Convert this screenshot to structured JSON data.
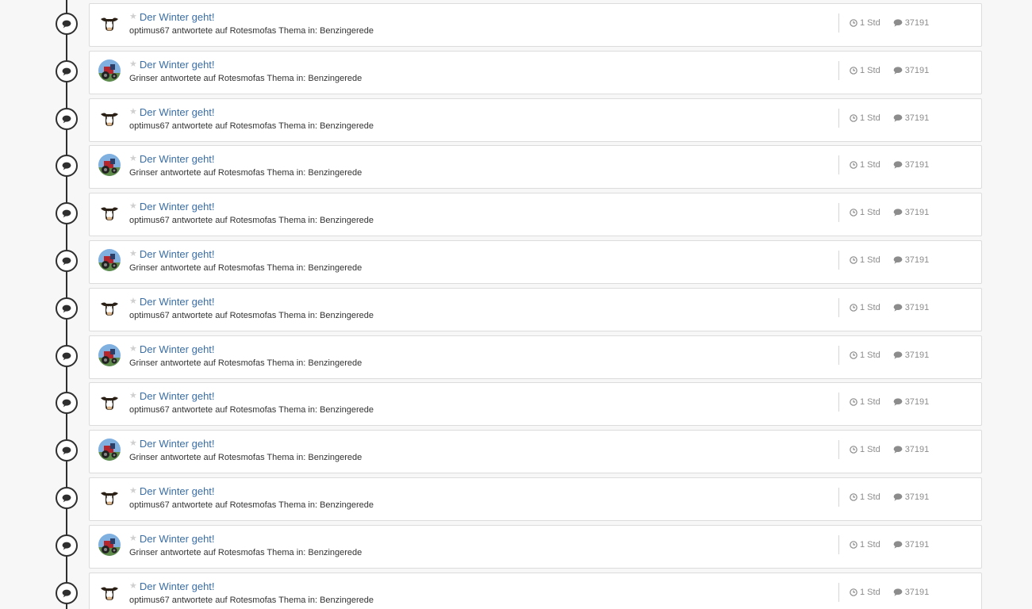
{
  "activities": [
    {
      "title": "Der Winter geht!",
      "subtitle": "optimus67 antwortete auf Rotesmofas Thema in: Benzingerede",
      "avatar": "cow-avatar",
      "time": "1 Std",
      "replies": "37191"
    },
    {
      "title": "Der Winter geht!",
      "subtitle": "Grinser antwortete auf Rotesmofas Thema in: Benzingerede",
      "avatar": "tractor-avatar",
      "time": "1 Std",
      "replies": "37191"
    },
    {
      "title": "Der Winter geht!",
      "subtitle": "optimus67 antwortete auf Rotesmofas Thema in: Benzingerede",
      "avatar": "cow-avatar",
      "time": "1 Std",
      "replies": "37191"
    },
    {
      "title": "Der Winter geht!",
      "subtitle": "Grinser antwortete auf Rotesmofas Thema in: Benzingerede",
      "avatar": "tractor-avatar",
      "time": "1 Std",
      "replies": "37191"
    },
    {
      "title": "Der Winter geht!",
      "subtitle": "optimus67 antwortete auf Rotesmofas Thema in: Benzingerede",
      "avatar": "cow-avatar",
      "time": "1 Std",
      "replies": "37191"
    },
    {
      "title": "Der Winter geht!",
      "subtitle": "Grinser antwortete auf Rotesmofas Thema in: Benzingerede",
      "avatar": "tractor-avatar",
      "time": "1 Std",
      "replies": "37191"
    },
    {
      "title": "Der Winter geht!",
      "subtitle": "optimus67 antwortete auf Rotesmofas Thema in: Benzingerede",
      "avatar": "cow-avatar",
      "time": "1 Std",
      "replies": "37191"
    },
    {
      "title": "Der Winter geht!",
      "subtitle": "Grinser antwortete auf Rotesmofas Thema in: Benzingerede",
      "avatar": "tractor-avatar",
      "time": "1 Std",
      "replies": "37191"
    },
    {
      "title": "Der Winter geht!",
      "subtitle": "optimus67 antwortete auf Rotesmofas Thema in: Benzingerede",
      "avatar": "cow-avatar",
      "time": "1 Std",
      "replies": "37191"
    },
    {
      "title": "Der Winter geht!",
      "subtitle": "Grinser antwortete auf Rotesmofas Thema in: Benzingerede",
      "avatar": "tractor-avatar",
      "time": "1 Std",
      "replies": "37191"
    },
    {
      "title": "Der Winter geht!",
      "subtitle": "optimus67 antwortete auf Rotesmofas Thema in: Benzingerede",
      "avatar": "cow-avatar",
      "time": "1 Std",
      "replies": "37191"
    },
    {
      "title": "Der Winter geht!",
      "subtitle": "Grinser antwortete auf Rotesmofas Thema in: Benzingerede",
      "avatar": "tractor-avatar",
      "time": "1 Std",
      "replies": "37191"
    },
    {
      "title": "Der Winter geht!",
      "subtitle": "optimus67 antwortete auf Rotesmofas Thema in: Benzingerede",
      "avatar": "cow-avatar",
      "time": "1 Std",
      "replies": "37191"
    }
  ],
  "icons": {
    "timeline_node": "comment-bubble-icon",
    "favorite": "star-icon",
    "time": "clock-icon",
    "replies": "comment-icon"
  },
  "colors": {
    "title_link": "#3a6ea5",
    "meta_text": "#8c8c8c",
    "timeline": "#2f2f2f"
  }
}
